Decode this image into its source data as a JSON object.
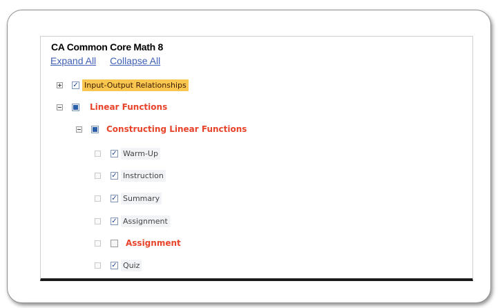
{
  "title": "CA Common Core Math 8",
  "links": {
    "expand_all": "Expand All",
    "collapse_all": "Collapse All"
  },
  "tree": {
    "input_output": "Input-Output Relationships",
    "linear_functions": "Linear Functions",
    "constructing": "Constructing Linear Functions",
    "items": [
      "Warm-Up",
      "Instruction",
      "Summary",
      "Assignment",
      "Assignment",
      "Quiz"
    ]
  },
  "check_glyph": "✓",
  "colors": {
    "highlight": "#f9c74f",
    "red_label": "#e8432a",
    "link": "#3f5fb8"
  }
}
